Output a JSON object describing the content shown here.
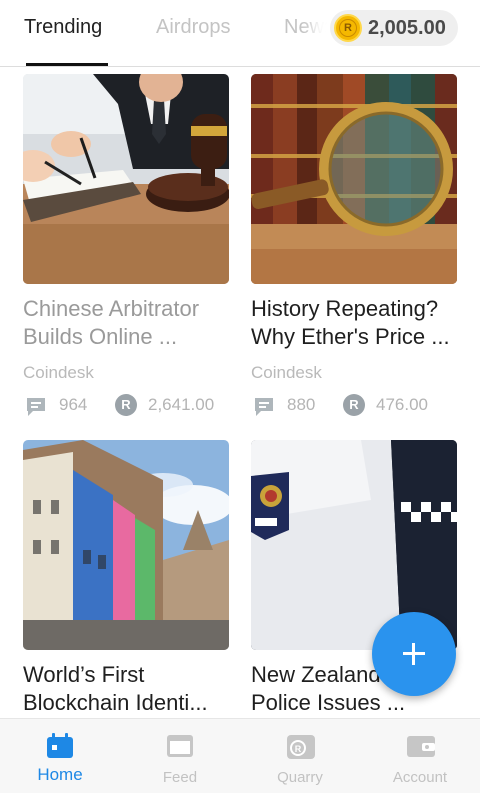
{
  "top_tabs": [
    {
      "label": "Trending",
      "active": true
    },
    {
      "label": "Airdrops",
      "active": false
    },
    {
      "label": "News",
      "active": false
    }
  ],
  "balance": {
    "coin_symbol": "R",
    "amount": "2,005.00"
  },
  "articles": [
    {
      "title_lines": [
        "Chinese Arbitrator",
        "Builds Online ..."
      ],
      "source": "Coindesk",
      "comments": "964",
      "coins": "2,641.00",
      "image_icon": "gavel-signing-photo",
      "dimmed": true
    },
    {
      "title_lines": [
        "History Repeating?",
        "Why Ether's Price ..."
      ],
      "source": "Coindesk",
      "comments": "880",
      "coins": "476.00",
      "image_icon": "magnifying-glass-books-photo",
      "dimmed": false
    },
    {
      "title_lines": [
        "World’s First",
        "Blockchain Identi..."
      ],
      "image_icon": "colorful-street-photo",
      "dimmed": false
    },
    {
      "title_lines": [
        "New Zealand",
        "Police Issues ..."
      ],
      "image_icon": "police-officer-photo",
      "dimmed": false
    }
  ],
  "stat_icons": {
    "comments": "comment-icon",
    "coins": "r-coin-icon"
  },
  "bottom_nav": [
    {
      "label": "Home",
      "icon": "calendar-icon",
      "active": true
    },
    {
      "label": "Feed",
      "icon": "feed-icon",
      "active": false
    },
    {
      "label": "Quarry",
      "icon": "quarry-icon",
      "active": false
    },
    {
      "label": "Account",
      "icon": "wallet-icon",
      "active": false
    }
  ],
  "colors": {
    "accent": "#1e88e5",
    "fab": "#2a93ee",
    "coin": "#f5b800",
    "inactive": "#c2c2c2"
  }
}
